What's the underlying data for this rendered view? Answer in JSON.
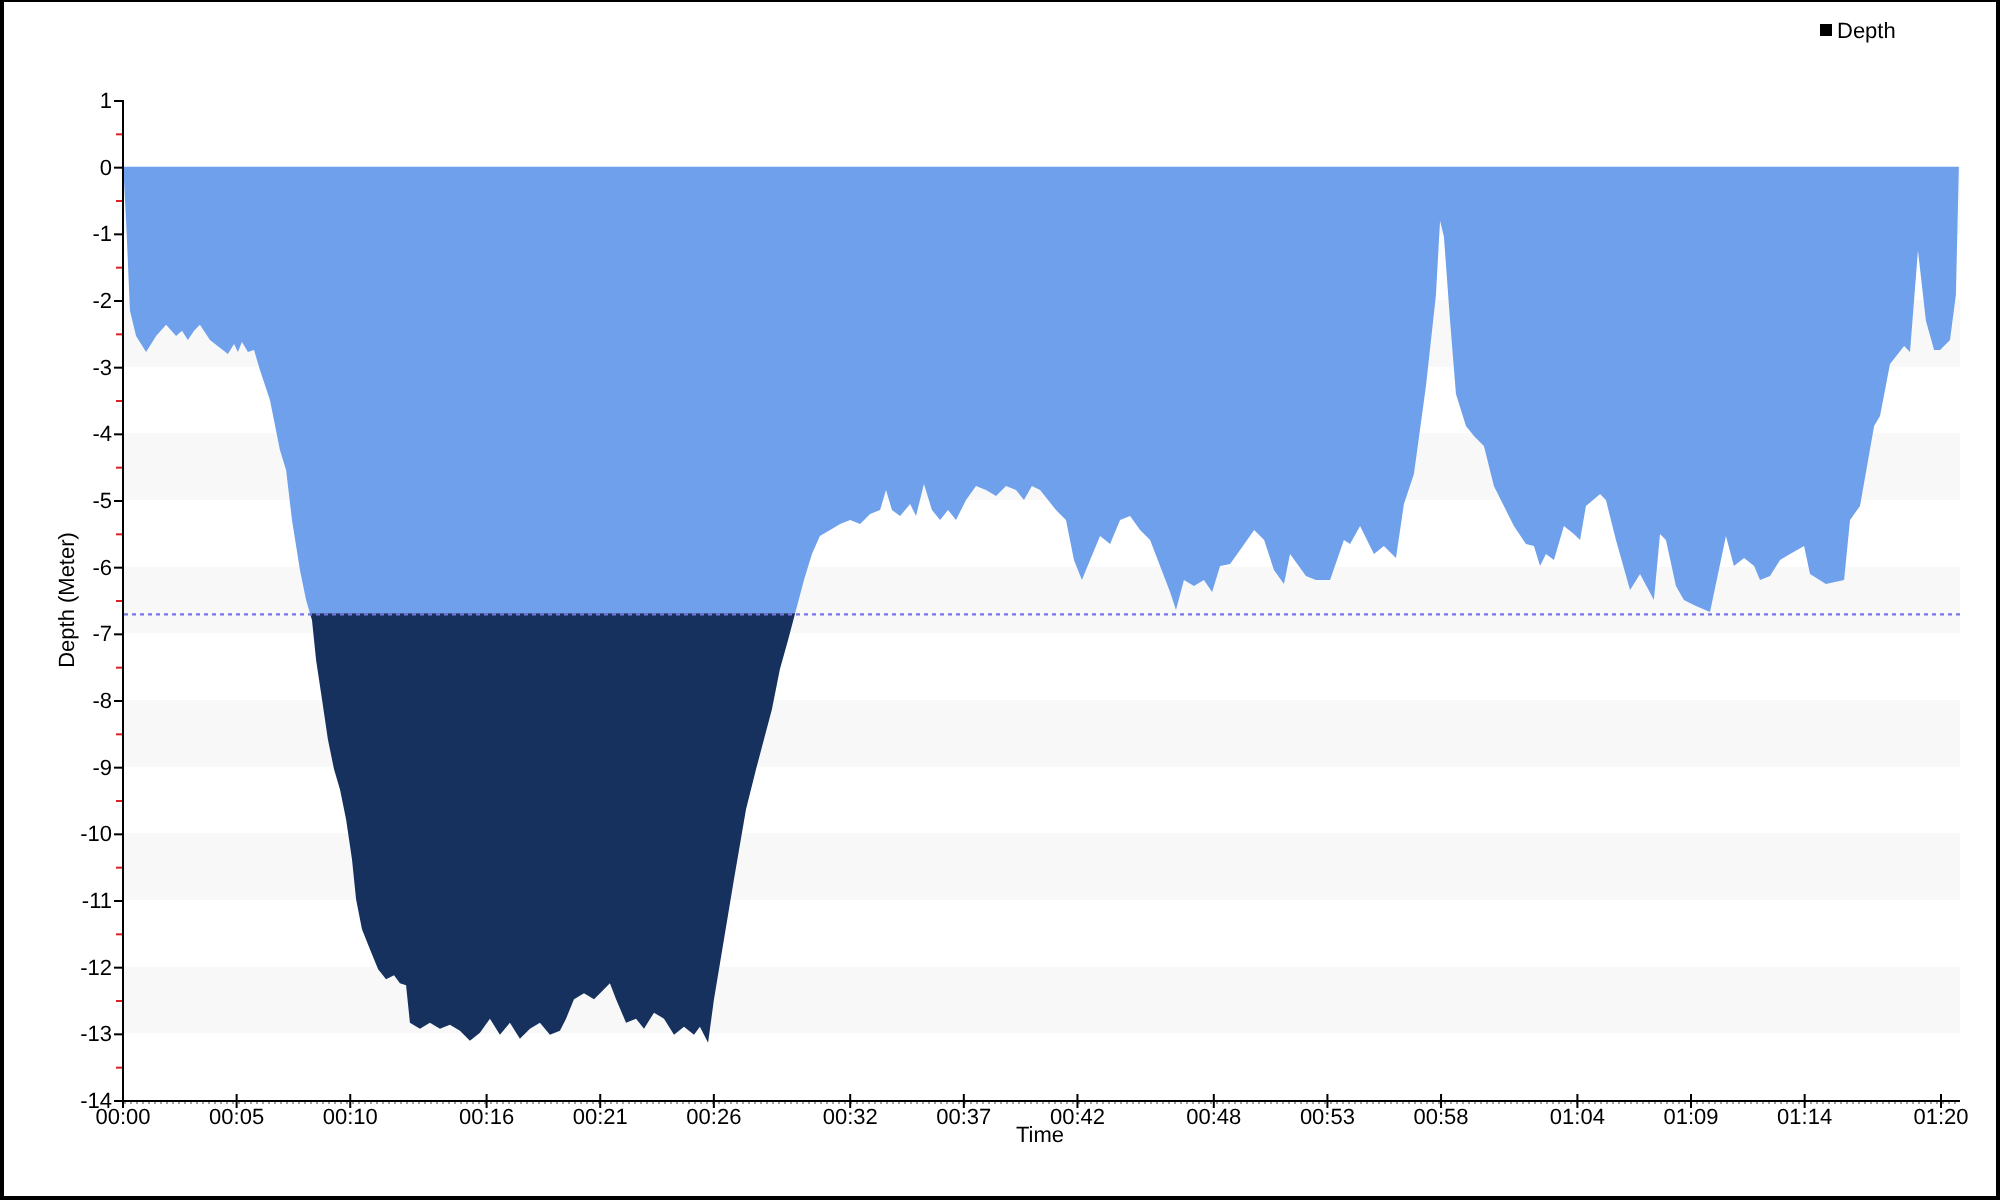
{
  "chart": {
    "chart_data": {
      "type": "area",
      "xlabel": "Time",
      "ylabel": "Depth (Meter)",
      "stacked": true,
      "x": [
        0,
        0.09,
        0.18,
        0.35,
        0.62,
        1.06,
        1.5,
        1.94,
        2.38,
        2.64,
        2.9,
        3.17,
        3.43,
        3.87,
        4.66,
        4.93,
        5.1,
        5.28,
        5.54,
        5.81,
        6.07,
        6.51,
        6.95,
        7.22,
        7.48,
        7.83,
        8.1,
        8.27,
        8.36,
        8.54,
        8.8,
        9.06,
        9.33,
        9.59,
        9.86,
        10.12,
        10.3,
        10.56,
        10.91,
        11.27,
        11.62,
        11.97,
        12.23,
        12.5,
        12.67,
        13.11,
        13.55,
        13.99,
        14.43,
        14.87,
        15.31,
        15.75,
        16.19,
        16.63,
        17.07,
        17.51,
        17.95,
        18.39,
        18.83,
        19.27,
        19.54,
        19.89,
        20.33,
        20.77,
        21.21,
        21.47,
        21.74,
        22.18,
        22.62,
        22.97,
        23.41,
        23.85,
        24.29,
        24.73,
        25.17,
        25.43,
        25.79,
        26.05,
        26.49,
        26.93,
        27.46,
        27.9,
        28.25,
        28.6,
        28.95,
        29.31,
        29.62,
        29.66,
        30.01,
        30.36,
        30.71,
        31.16,
        31.6,
        32.04,
        32.48,
        32.92,
        33.36,
        33.62,
        33.88,
        34.24,
        34.68,
        34.94,
        35.29,
        35.64,
        36,
        36.35,
        36.7,
        37.14,
        37.58,
        38.02,
        38.46,
        38.9,
        39.34,
        39.69,
        40.04,
        40.4,
        40.75,
        41.1,
        41.54,
        41.89,
        42.24,
        42.6,
        43.04,
        43.48,
        43.92,
        44.36,
        44.8,
        45.24,
        45.68,
        46.12,
        46.38,
        46.73,
        47.17,
        47.61,
        47.97,
        48.32,
        48.76,
        49.2,
        49.82,
        50.26,
        50.69,
        51.13,
        51.4,
        52.1,
        52.54,
        53.16,
        53.77,
        54.04,
        54.48,
        55.09,
        55.53,
        56.06,
        56.41,
        56.85,
        57.38,
        57.82,
        58,
        58.17,
        58.44,
        58.7,
        59.14,
        59.49,
        59.93,
        60.37,
        61.25,
        61.78,
        62.13,
        62.4,
        62.66,
        63.01,
        63.45,
        63.89,
        64.16,
        64.42,
        65.04,
        65.3,
        65.74,
        66.36,
        66.8,
        67.41,
        67.68,
        67.94,
        68.38,
        68.73,
        69.26,
        69.88,
        70.58,
        70.93,
        71.38,
        71.82,
        72.08,
        72.52,
        72.96,
        73.4,
        74.02,
        74.28,
        74.98,
        75.78,
        76.04,
        76.48,
        77.1,
        77.36,
        77.8,
        78.42,
        78.68,
        79.03,
        79.38,
        79.74,
        80,
        80.44,
        80.7,
        80.83
      ],
      "series": [
        {
          "name": "Depth",
          "color": "#6fa0eb",
          "values": [
            0,
            -0.21,
            -0.81,
            -2.16,
            -2.54,
            -2.78,
            -2.54,
            -2.37,
            -2.54,
            -2.46,
            -2.6,
            -2.46,
            -2.37,
            -2.6,
            -2.81,
            -2.66,
            -2.78,
            -2.63,
            -2.78,
            -2.75,
            -3.05,
            -3.5,
            -4.25,
            -4.55,
            -5.3,
            -6.05,
            -6.5,
            -6.7,
            -6.7,
            -6.7,
            -6.7,
            -6.7,
            -6.7,
            -6.7,
            -6.7,
            -6.7,
            -6.7,
            -6.7,
            -6.7,
            -6.7,
            -6.7,
            -6.7,
            -6.7,
            -6.7,
            -6.7,
            -6.7,
            -6.7,
            -6.7,
            -6.7,
            -6.7,
            -6.7,
            -6.7,
            -6.7,
            -6.7,
            -6.7,
            -6.7,
            -6.7,
            -6.7,
            -6.7,
            -6.7,
            -6.7,
            -6.7,
            -6.7,
            -6.7,
            -6.7,
            -6.7,
            -6.7,
            -6.7,
            -6.7,
            -6.7,
            -6.7,
            -6.7,
            -6.7,
            -6.7,
            -6.7,
            -6.7,
            -6.7,
            -6.7,
            -6.7,
            -6.7,
            -6.7,
            -6.7,
            -6.7,
            -6.7,
            -6.7,
            -6.7,
            -6.7,
            -6.65,
            -6.2,
            -5.81,
            -5.54,
            -5.45,
            -5.36,
            -5.3,
            -5.36,
            -5.21,
            -5.15,
            -4.85,
            -5.15,
            -5.24,
            -5.06,
            -5.24,
            -4.76,
            -5.15,
            -5.3,
            -5.15,
            -5.3,
            -5,
            -4.79,
            -4.85,
            -4.94,
            -4.79,
            -4.85,
            -5,
            -4.79,
            -4.85,
            -5,
            -5.15,
            -5.3,
            -5.9,
            -6.2,
            -5.9,
            -5.54,
            -5.66,
            -5.3,
            -5.24,
            -5.45,
            -5.6,
            -5.99,
            -6.38,
            -6.65,
            -6.2,
            -6.29,
            -6.2,
            -6.38,
            -5.99,
            -5.96,
            -5.75,
            -5.45,
            -5.6,
            -6.05,
            -6.26,
            -5.81,
            -6.14,
            -6.2,
            -6.2,
            -5.6,
            -5.66,
            -5.39,
            -5.81,
            -5.69,
            -5.87,
            -5.06,
            -4.61,
            -3.29,
            -1.92,
            -0.81,
            -1.05,
            -2.31,
            -3.41,
            -3.89,
            -4.04,
            -4.19,
            -4.79,
            -5.39,
            -5.66,
            -5.69,
            -5.99,
            -5.81,
            -5.9,
            -5.39,
            -5.51,
            -5.6,
            -5.09,
            -4.91,
            -5,
            -5.6,
            -6.35,
            -6.11,
            -6.5,
            -5.51,
            -5.6,
            -6.29,
            -6.5,
            -6.59,
            -6.68,
            -5.54,
            -5.99,
            -5.87,
            -5.99,
            -6.2,
            -6.14,
            -5.9,
            -5.81,
            -5.69,
            -6.11,
            -6.26,
            -6.2,
            -5.3,
            -5.09,
            -3.89,
            -3.74,
            -2.96,
            -2.69,
            -2.78,
            -1.26,
            -2.31,
            -2.75,
            -2.75,
            -2.6,
            -1.92,
            0
          ]
        },
        {
          "color": "#17315e",
          "values": [
            null,
            null,
            null,
            null,
            null,
            null,
            null,
            null,
            null,
            null,
            null,
            null,
            null,
            null,
            null,
            null,
            null,
            null,
            null,
            null,
            null,
            null,
            null,
            null,
            null,
            null,
            null,
            0,
            -0.1,
            -0.7,
            -1.29,
            -1.89,
            -2.34,
            -2.64,
            -3.09,
            -3.69,
            -4.29,
            -4.74,
            -5.04,
            -5.34,
            -5.49,
            -5.43,
            -5.55,
            -5.58,
            -6.14,
            -6.23,
            -6.14,
            -6.23,
            -6.17,
            -6.26,
            -6.41,
            -6.29,
            -6.08,
            -6.32,
            -6.14,
            -6.38,
            -6.23,
            -6.14,
            -6.32,
            -6.26,
            -6.08,
            -5.79,
            -5.7,
            -5.79,
            -5.64,
            -5.55,
            -5.79,
            -6.14,
            -6.08,
            -6.23,
            -5.99,
            -6.08,
            -6.32,
            -6.2,
            -6.32,
            -6.2,
            -6.44,
            -5.79,
            -4.89,
            -3.99,
            -2.94,
            -2.34,
            -1.89,
            -1.44,
            -0.84,
            -0.4,
            0,
            null,
            null,
            null,
            null,
            null,
            null,
            null,
            null,
            null,
            null,
            null,
            null,
            null,
            null,
            null,
            null,
            null,
            null,
            null,
            null,
            null,
            null,
            null,
            null,
            null,
            null,
            null,
            null,
            null,
            null,
            null,
            null,
            null,
            null,
            null,
            null,
            null,
            null,
            null,
            null,
            null,
            null,
            null,
            null,
            null,
            null,
            null,
            null,
            null,
            null,
            null,
            null,
            null,
            null,
            null,
            null,
            null,
            null,
            null,
            null,
            null,
            null,
            null,
            null,
            null,
            null,
            null,
            null,
            null,
            null,
            null,
            null,
            null,
            null,
            null,
            null,
            null,
            null,
            null,
            null,
            null,
            null,
            null,
            null,
            null,
            null,
            null,
            null,
            null,
            null,
            null,
            null,
            null,
            null,
            null,
            null,
            null,
            null,
            null,
            null,
            null,
            null,
            null,
            null,
            null,
            null,
            null,
            null,
            null,
            null,
            null,
            null,
            null,
            null,
            null,
            null,
            null,
            null,
            null,
            null,
            null,
            null,
            null,
            null,
            null
          ]
        }
      ],
      "xlim": [
        0,
        80.88
      ],
      "ylim": [
        -14,
        1
      ],
      "xticks": [
        {
          "value": 0,
          "label": "00:00"
        },
        {
          "value": 5,
          "label": "00:05"
        },
        {
          "value": 10,
          "label": "00:10"
        },
        {
          "value": 16,
          "label": "00:16"
        },
        {
          "value": 21,
          "label": "00:21"
        },
        {
          "value": 26,
          "label": "00:26"
        },
        {
          "value": 32,
          "label": "00:32"
        },
        {
          "value": 37,
          "label": "00:37"
        },
        {
          "value": 42,
          "label": "00:42"
        },
        {
          "value": 48,
          "label": "00:48"
        },
        {
          "value": 53,
          "label": "00:53"
        },
        {
          "value": 58,
          "label": "00:58"
        },
        {
          "value": 64,
          "label": "01:04"
        },
        {
          "value": 69,
          "label": "01:09"
        },
        {
          "value": 74,
          "label": "01:14"
        },
        {
          "value": 80,
          "label": "01:20"
        }
      ],
      "yticks": [
        1,
        0,
        -1,
        -2,
        -3,
        -4,
        -5,
        -6,
        -7,
        -8,
        -9,
        -10,
        -11,
        -12,
        -13,
        -14
      ],
      "ref_lines": [
        {
          "axis": "y",
          "value": -6.7
        }
      ]
    }
  }
}
